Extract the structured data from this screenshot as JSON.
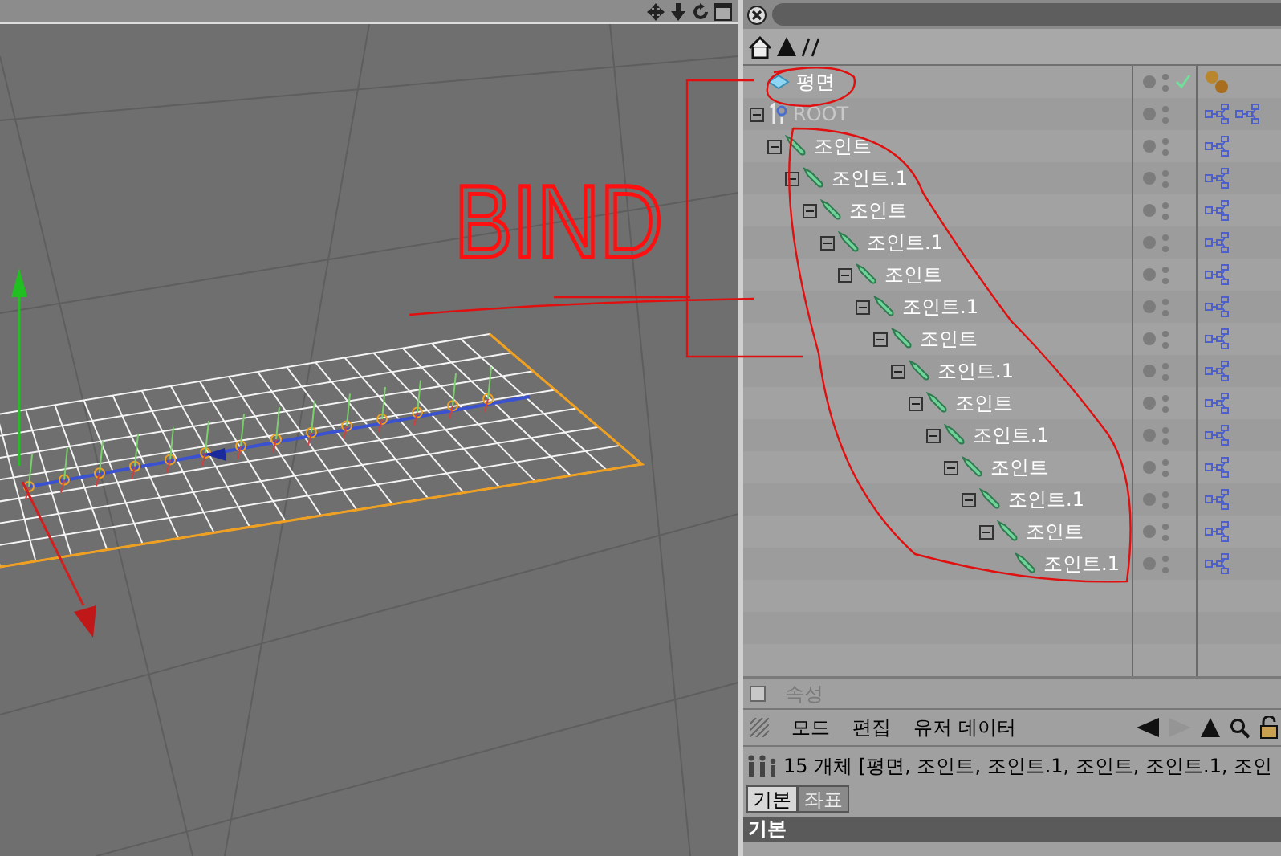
{
  "viewport": {
    "annotation": {
      "text": "BIND"
    }
  },
  "object_manager": {
    "objects": [
      {
        "name": "평면",
        "kind": "plane",
        "checked": true,
        "disabled": false,
        "tags": [
          {
            "kind": "material"
          }
        ]
      },
      {
        "name": "ROOT",
        "kind": "null",
        "checked": false,
        "disabled": true,
        "expanded": true,
        "tags": [
          {
            "kind": "ik"
          },
          {
            "kind": "ik"
          }
        ],
        "children": [
          {
            "name": "조인트",
            "kind": "joint",
            "checked": false,
            "disabled": false,
            "expanded": true,
            "tags": [
              {
                "kind": "ik"
              }
            ],
            "children": [
              {
                "name": "조인트.1",
                "kind": "joint",
                "checked": false,
                "disabled": false,
                "expanded": true,
                "tags": [
                  {
                    "kind": "ik"
                  }
                ],
                "children": [
                  {
                    "name": "조인트",
                    "kind": "joint",
                    "checked": false,
                    "disabled": false,
                    "expanded": true,
                    "tags": [
                      {
                        "kind": "ik"
                      }
                    ],
                    "children": [
                      {
                        "name": "조인트.1",
                        "kind": "joint",
                        "checked": false,
                        "disabled": false,
                        "expanded": true,
                        "tags": [
                          {
                            "kind": "ik"
                          }
                        ],
                        "children": [
                          {
                            "name": "조인트",
                            "kind": "joint",
                            "checked": false,
                            "disabled": false,
                            "expanded": true,
                            "tags": [
                              {
                                "kind": "ik"
                              }
                            ],
                            "children": [
                              {
                                "name": "조인트.1",
                                "kind": "joint",
                                "checked": false,
                                "disabled": false,
                                "expanded": true,
                                "tags": [
                                  {
                                    "kind": "ik"
                                  }
                                ],
                                "children": [
                                  {
                                    "name": "조인트",
                                    "kind": "joint",
                                    "checked": false,
                                    "disabled": false,
                                    "expanded": true,
                                    "tags": [
                                      {
                                        "kind": "ik"
                                      }
                                    ],
                                    "children": [
                                      {
                                        "name": "조인트.1",
                                        "kind": "joint",
                                        "checked": false,
                                        "disabled": false,
                                        "expanded": true,
                                        "tags": [
                                          {
                                            "kind": "ik"
                                          }
                                        ],
                                        "children": [
                                          {
                                            "name": "조인트",
                                            "kind": "joint",
                                            "checked": false,
                                            "disabled": false,
                                            "expanded": true,
                                            "tags": [
                                              {
                                                "kind": "ik"
                                              }
                                            ],
                                            "children": [
                                              {
                                                "name": "조인트.1",
                                                "kind": "joint",
                                                "checked": false,
                                                "disabled": false,
                                                "expanded": true,
                                                "tags": [
                                                  {
                                                    "kind": "ik"
                                                  }
                                                ],
                                                "children": [
                                                  {
                                                    "name": "조인트",
                                                    "kind": "joint",
                                                    "checked": false,
                                                    "disabled": false,
                                                    "expanded": true,
                                                    "tags": [
                                                      {
                                                        "kind": "ik"
                                                      }
                                                    ],
                                                    "children": [
                                                      {
                                                        "name": "조인트.1",
                                                        "kind": "joint",
                                                        "checked": false,
                                                        "disabled": false,
                                                        "expanded": true,
                                                        "tags": [
                                                          {
                                                            "kind": "ik"
                                                          }
                                                        ],
                                                        "children": [
                                                          {
                                                            "name": "조인트",
                                                            "kind": "joint",
                                                            "checked": false,
                                                            "disabled": false,
                                                            "expanded": true,
                                                            "tags": [
                                                              {
                                                                "kind": "ik"
                                                              }
                                                            ],
                                                            "children": [
                                                              {
                                                                "name": "조인트.1",
                                                                "kind": "joint",
                                                                "checked": false,
                                                                "disabled": false,
                                                                "tags": [
                                                                  {
                                                                    "kind": "ik"
                                                                  }
                                                                ]
                                                              }
                                                            ]
                                                          }
                                                        ]
                                                      }
                                                    ]
                                                  }
                                                ]
                                              }
                                            ]
                                          }
                                        ]
                                      }
                                    ]
                                  }
                                ]
                              }
                            ]
                          }
                        ]
                      }
                    ]
                  }
                ]
              }
            ]
          }
        ]
      }
    ]
  },
  "attributes": {
    "checked": false,
    "title": "속성",
    "menu": [
      "모드",
      "편집",
      "유저 데이터"
    ],
    "nav": {
      "back_disabled": false,
      "forward_disabled": true
    },
    "summary": "15 개체 [평면, 조인트, 조인트.1, 조인트, 조인트.1, 조인",
    "tabs": [
      {
        "label": "기본",
        "selected": true
      },
      {
        "label": "좌표",
        "selected": false
      }
    ],
    "section": "기본"
  }
}
